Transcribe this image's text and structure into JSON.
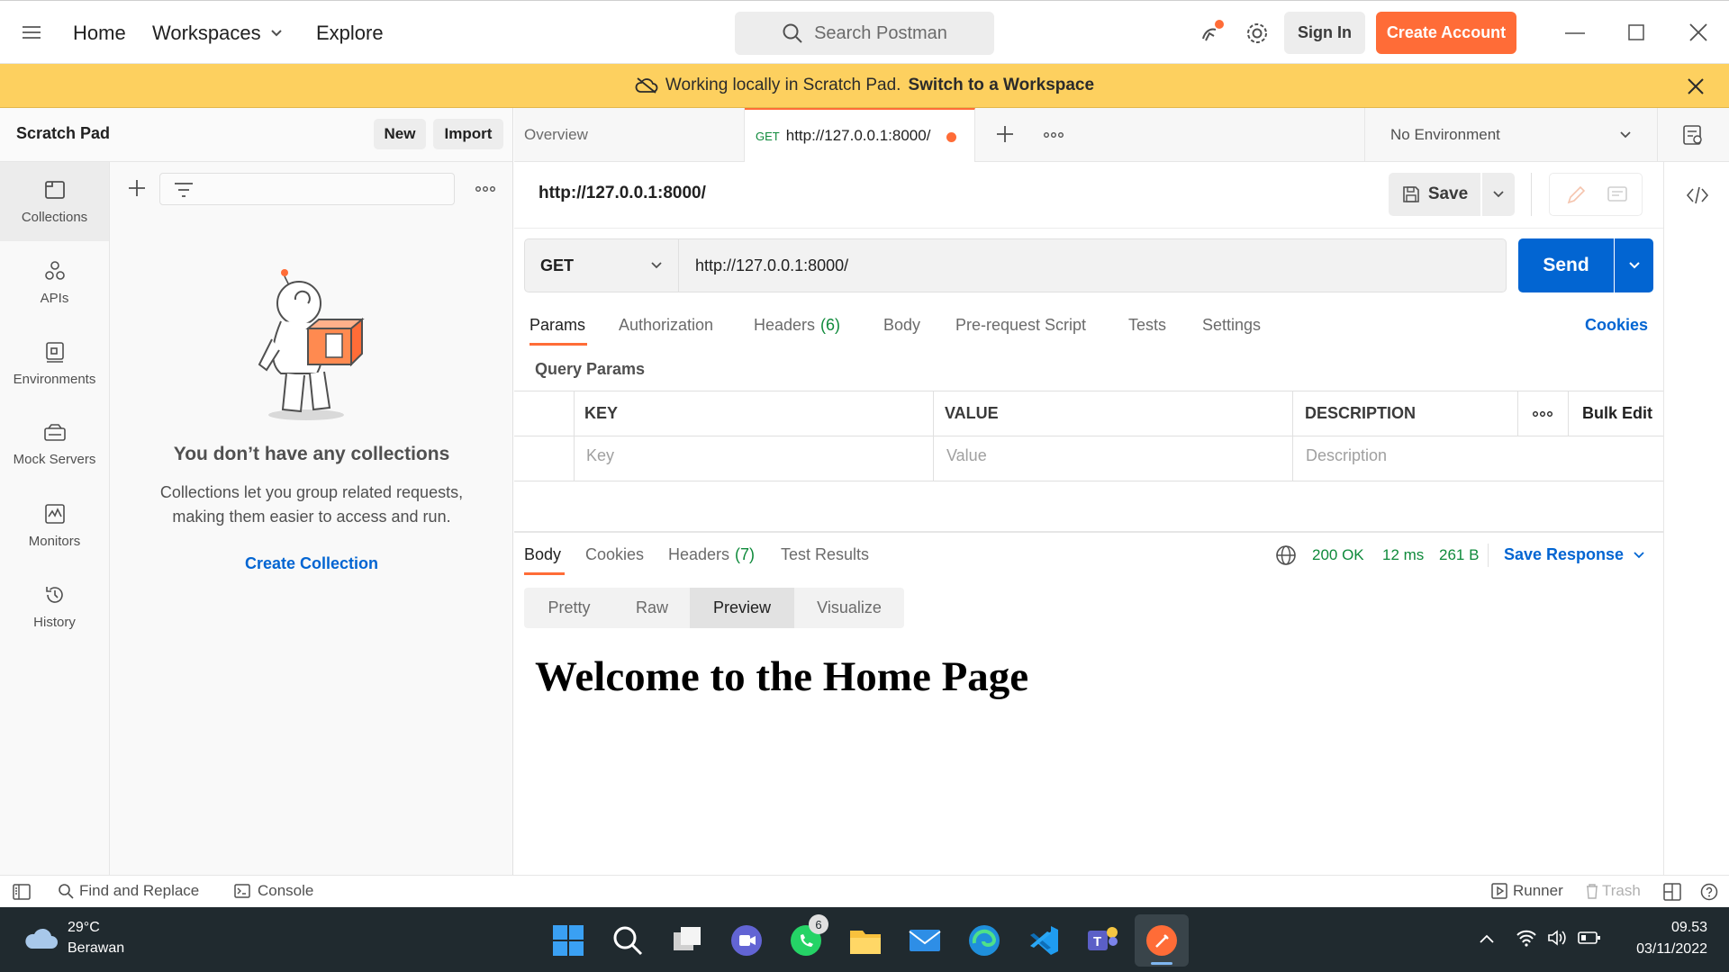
{
  "topbar": {
    "nav": [
      "Home",
      "Workspaces",
      "Explore"
    ],
    "search_placeholder": "Search Postman",
    "sign_in": "Sign In",
    "create_account": "Create Account"
  },
  "banner": {
    "text": "Working locally in Scratch Pad.",
    "link": "Switch to a Workspace"
  },
  "sidebar": {
    "title": "Scratch Pad",
    "new_label": "New",
    "import_label": "Import",
    "rail": [
      {
        "label": "Collections",
        "icon": "collections-icon"
      },
      {
        "label": "APIs",
        "icon": "apis-icon"
      },
      {
        "label": "Environments",
        "icon": "environments-icon"
      },
      {
        "label": "Mock Servers",
        "icon": "mock-servers-icon"
      },
      {
        "label": "Monitors",
        "icon": "monitors-icon"
      },
      {
        "label": "History",
        "icon": "history-icon"
      }
    ],
    "empty_title": "You don’t have any collections",
    "empty_line1": "Collections let you group related requests,",
    "empty_line2": "making them easier to access and run.",
    "create_collection": "Create Collection"
  },
  "tabs": {
    "overview": "Overview",
    "active_method": "GET",
    "active_url": "http://127.0.0.1:8000/",
    "environment": "No Environment"
  },
  "request": {
    "title": "http://127.0.0.1:8000/",
    "save": "Save",
    "method": "GET",
    "url": "http://127.0.0.1:8000/",
    "send": "Send",
    "tabs": [
      "Params",
      "Authorization",
      "Headers",
      "Body",
      "Pre-request Script",
      "Tests",
      "Settings"
    ],
    "headers_count": "(6)",
    "cookies": "Cookies",
    "query_params_label": "Query Params",
    "columns": [
      "KEY",
      "VALUE",
      "DESCRIPTION"
    ],
    "bulk_edit": "Bulk Edit",
    "placeholders": [
      "Key",
      "Value",
      "Description"
    ]
  },
  "response": {
    "tabs": [
      "Body",
      "Cookies",
      "Headers",
      "Test Results"
    ],
    "headers_count": "(7)",
    "status": "200 OK",
    "time": "12 ms",
    "size": "261 B",
    "save_response": "Save Response",
    "views": [
      "Pretty",
      "Raw",
      "Preview",
      "Visualize"
    ],
    "preview_heading": "Welcome to the Home Page"
  },
  "statusbar": {
    "find_replace": "Find and Replace",
    "console": "Console",
    "runner": "Runner",
    "trash": "Trash"
  },
  "taskbar": {
    "temp": "29°C",
    "weather": "Berawan",
    "whatsapp_badge": "6",
    "time": "09.53",
    "date": "03/11/2022"
  },
  "colors": {
    "accent": "#ff6c37",
    "send_blue": "#0265d2",
    "banner": "#fdd05f",
    "ok_green": "#0f8a3b"
  }
}
